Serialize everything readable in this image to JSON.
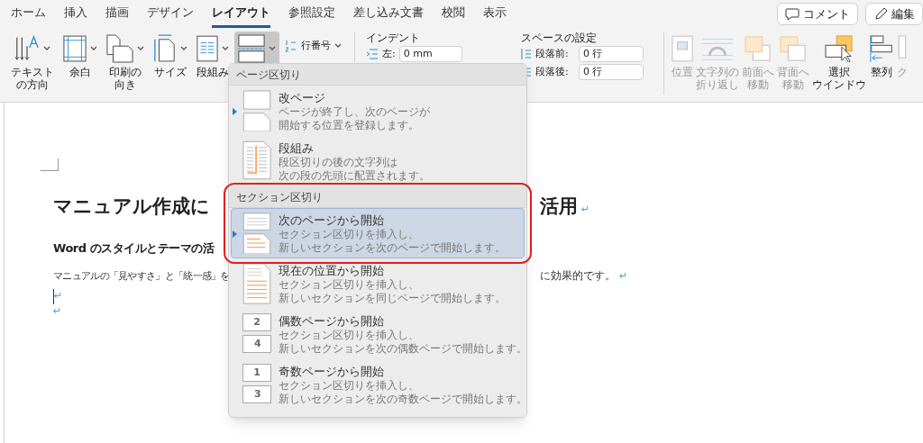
{
  "tabs": [
    {
      "label": "ホーム",
      "selected": false
    },
    {
      "label": "挿入",
      "selected": false
    },
    {
      "label": "描画",
      "selected": false
    },
    {
      "label": "デザイン",
      "selected": false
    },
    {
      "label": "レイアウト",
      "selected": true
    },
    {
      "label": "参照設定",
      "selected": false
    },
    {
      "label": "差し込み文書",
      "selected": false
    },
    {
      "label": "校閲",
      "selected": false
    },
    {
      "label": "表示",
      "selected": false
    }
  ],
  "top_buttons": [
    {
      "label": "コメント",
      "kind": "comment"
    },
    {
      "label": "編集",
      "kind": "edit"
    }
  ],
  "page_setup": [
    {
      "label": [
        "テキスト",
        "の方向"
      ],
      "kind": "text-direction",
      "pressed": false
    },
    {
      "label": [
        "余白"
      ],
      "kind": "margins",
      "pressed": false
    },
    {
      "label": [
        "印刷の",
        "向き"
      ],
      "kind": "orientation",
      "pressed": false
    },
    {
      "label": [
        "サイズ"
      ],
      "kind": "size",
      "pressed": false
    },
    {
      "label": [
        "段組み"
      ],
      "kind": "columns",
      "pressed": false
    },
    {
      "kind": "breaks",
      "pressed": true
    }
  ],
  "line_numbers": {
    "label": "行番号"
  },
  "indent": {
    "title": "インデント",
    "rows": [
      {
        "label": "左:",
        "value": "0 mm"
      }
    ]
  },
  "spacing": {
    "title": "スペースの設定",
    "rows": [
      {
        "label": "段落前:",
        "value": "0 行"
      },
      {
        "label": "段落後:",
        "value": "0 行"
      }
    ]
  },
  "arrange": [
    {
      "label": [
        "位置"
      ],
      "kind": "position",
      "disabled": true
    },
    {
      "label": [
        "文字列の",
        "折り返し"
      ],
      "kind": "wrap",
      "disabled": true
    },
    {
      "label": [
        "前面へ",
        "移動"
      ],
      "kind": "front",
      "disabled": true
    },
    {
      "label": [
        "背面へ",
        "移動"
      ],
      "kind": "back",
      "disabled": true
    },
    {
      "label": [
        "選択",
        "ウインドウ"
      ],
      "kind": "selection",
      "disabled": false
    },
    {
      "label": [
        "整列"
      ],
      "kind": "align",
      "disabled": false
    },
    {
      "label": [
        "ク"
      ],
      "kind": "group",
      "disabled": true
    }
  ],
  "document": {
    "title_left": "マニュアル作成に",
    "title_right": "活用",
    "title_mark": "↵",
    "heading": "Word のスタイルとテーマの活",
    "body_left": "マニュアルの「見やすさ」と「統一感」を",
    "body_right": "に効果的です。",
    "body_mark": "↵",
    "empty_marks": [
      "↵",
      "↵"
    ]
  },
  "menu": {
    "sections": [
      {
        "title": "ページ区切り",
        "highlighted": false,
        "items": [
          {
            "title": "改ページ",
            "lines": [
              "ページが終了し、次のページが",
              "開始する位置を登録します。"
            ],
            "kind": "page",
            "selected": false,
            "pointer": true
          },
          {
            "title": "段組み",
            "lines": [
              "段区切りの後の文字列は",
              "次の段の先頭に配置されます。"
            ],
            "kind": "column",
            "selected": false,
            "pointer": false
          }
        ]
      },
      {
        "title": "セクション区切り",
        "highlighted": true,
        "items": [
          {
            "title": "次のページから開始",
            "lines": [
              "セクション区切りを挿入し、",
              "新しいセクションを次のページで開始します。"
            ],
            "kind": "next",
            "selected": true,
            "pointer": true
          },
          {
            "title": "現在の位置から開始",
            "lines": [
              "セクション区切りを挿入し、",
              "新しいセクションを同じページで開始します。"
            ],
            "kind": "continuous",
            "selected": false,
            "pointer": false
          },
          {
            "title": "偶数ページから開始",
            "lines": [
              "セクション区切りを挿入し、",
              "新しいセクションを次の偶数ページで開始します。"
            ],
            "kind": "even",
            "selected": false,
            "pointer": false,
            "numbers": [
              "2",
              "4"
            ]
          },
          {
            "title": "奇数ページから開始",
            "lines": [
              "セクション区切りを挿入し、",
              "新しいセクションを次の奇数ページで開始します。"
            ],
            "kind": "odd",
            "selected": false,
            "pointer": false,
            "numbers": [
              "1",
              "3"
            ]
          }
        ]
      }
    ]
  }
}
